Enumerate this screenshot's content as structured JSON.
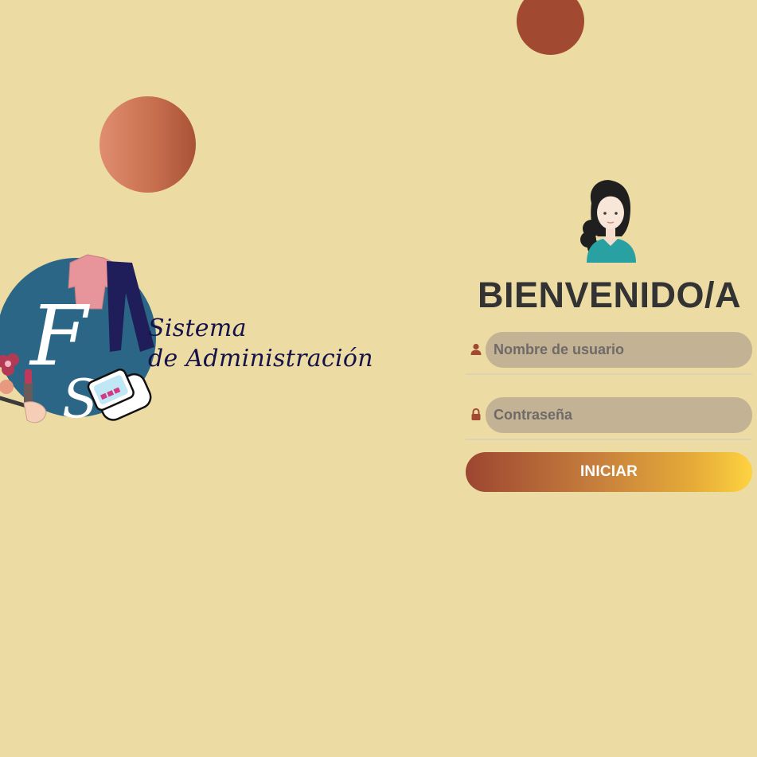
{
  "logo": {
    "letters": [
      "F",
      "S"
    ],
    "line1": "Sistema",
    "line2": "de Administración"
  },
  "login": {
    "title": "BIENVENIDO/A",
    "username": {
      "placeholder": "Nombre de usuario",
      "icon": "user-icon"
    },
    "password": {
      "placeholder": "Contraseña",
      "icon": "lock-icon"
    },
    "submit_label": "INICIAR"
  },
  "colors": {
    "background": "#ecdba2",
    "accent_dark": "#a24a31",
    "accent_light": "#fed341",
    "input_bg": "#c3b394",
    "title": "#333333"
  }
}
